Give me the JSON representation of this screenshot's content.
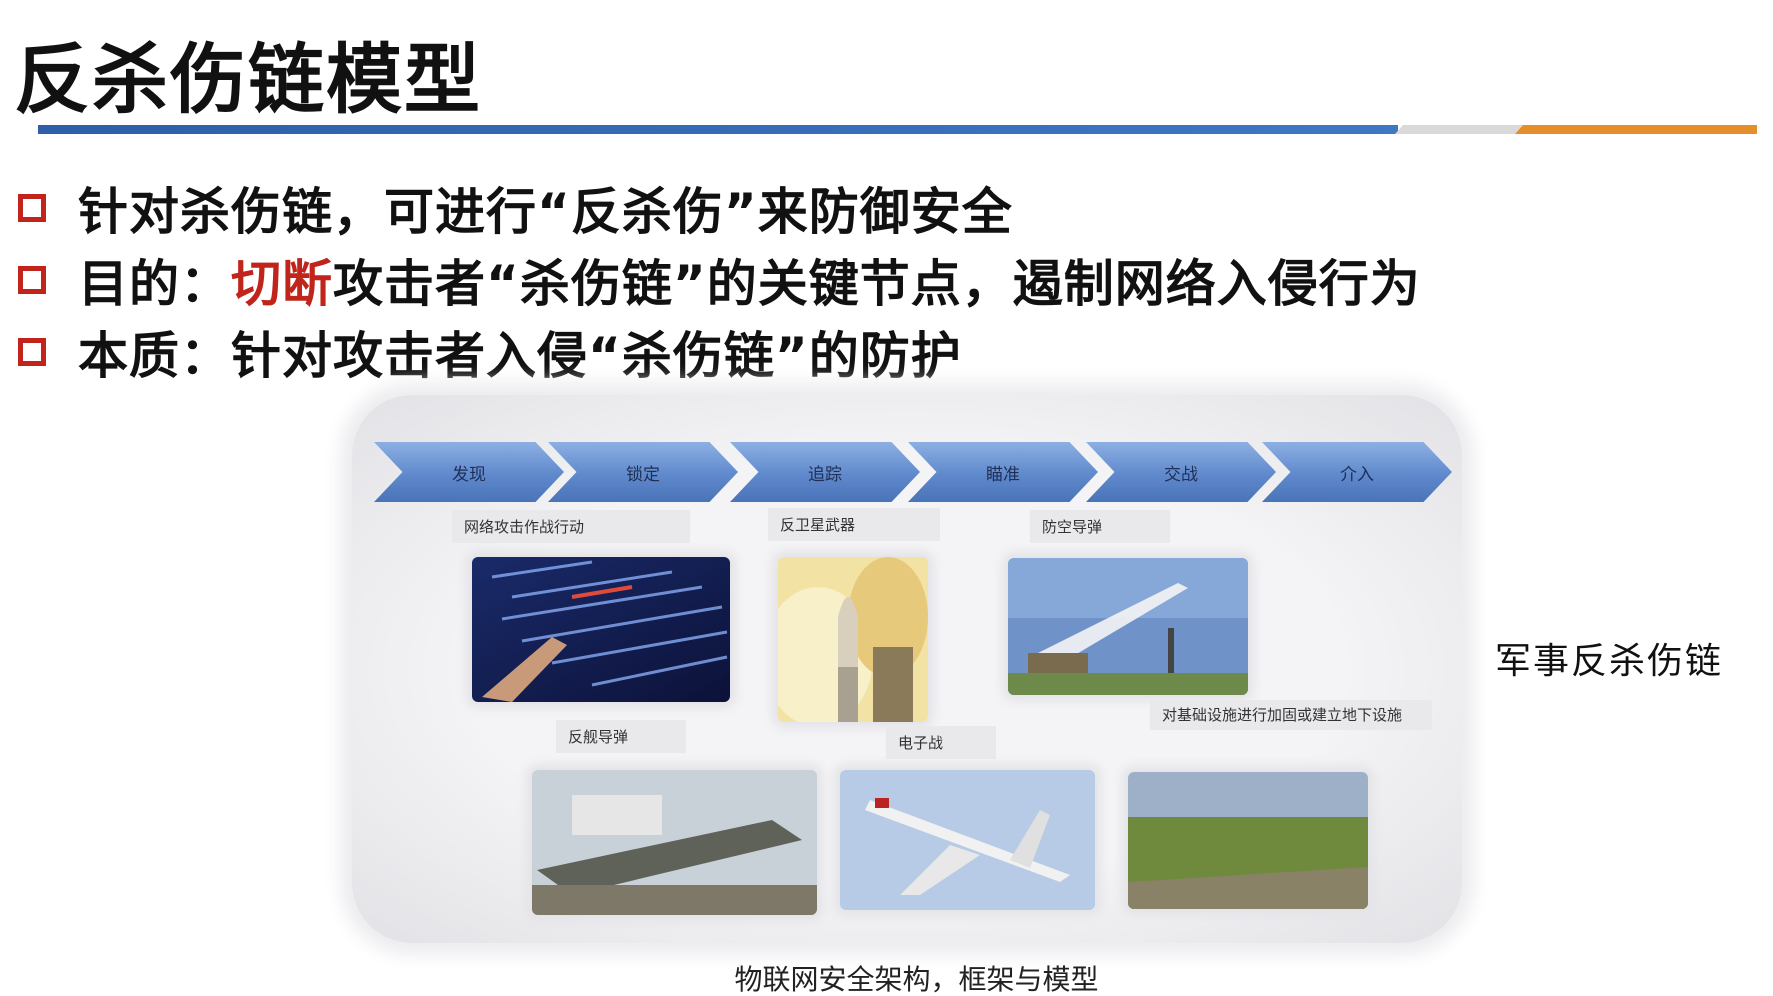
{
  "title": "反杀伤链模型",
  "bullets": [
    {
      "plain": "针对杀伤链，可进行“反杀伤”来防御安全"
    },
    {
      "prefix": "目的：",
      "highlight": "切断",
      "suffix": "攻击者“杀伤链”的关键节点，遏制网络入侵行为"
    },
    {
      "plain": "本质：针对攻击者入侵“杀伤链”的防护"
    }
  ],
  "chain_steps": [
    "发现",
    "锁定",
    "追踪",
    "瞄准",
    "交战",
    "介入"
  ],
  "labels": {
    "cyber": "网络攻击作战行动",
    "asat": "反卫星武器",
    "aa_missile": "防空导弹",
    "anti_ship": "反舰导弹",
    "ew": "电子战",
    "infra": "对基础设施进行加固或建立地下设施"
  },
  "side_label": "军事反杀伤链",
  "caption": "物联网安全架构，框架与模型",
  "colors": {
    "accent_red": "#c0241a",
    "rule_blue": "#3f77c4",
    "rule_orange": "#e58e2a",
    "chevron_blue": "#5f89cc"
  }
}
